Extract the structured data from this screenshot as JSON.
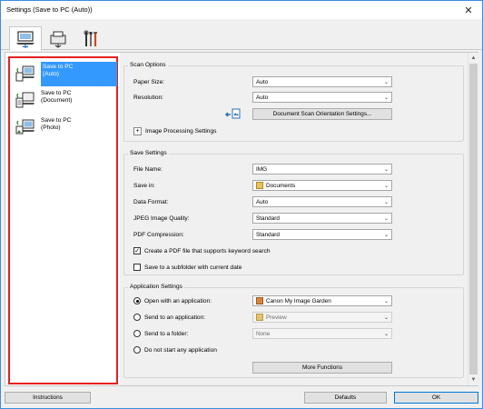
{
  "window": {
    "title": "Settings (Save to PC (Auto))",
    "close_glyph": "✕"
  },
  "tabs": [
    {
      "icon": "scan-from-computer-icon",
      "active": true
    },
    {
      "icon": "scan-from-operation-panel-icon",
      "active": false
    },
    {
      "icon": "general-settings-tools-icon",
      "active": false
    }
  ],
  "left_list": {
    "items": [
      {
        "label_line1": "Save to PC",
        "label_line2": "(Auto)",
        "selected": true,
        "icon": "save-to-pc-auto-icon"
      },
      {
        "label_line1": "Save to PC",
        "label_line2": "(Document)",
        "selected": false,
        "icon": "save-to-pc-document-icon"
      },
      {
        "label_line1": "Save to PC",
        "label_line2": "(Photo)",
        "selected": false,
        "icon": "save-to-pc-photo-icon"
      }
    ],
    "highlight_color": "#e5201f",
    "selection_color": "#3399ff"
  },
  "scan_options": {
    "legend": "Scan Options",
    "paper_size_label": "Paper Size:",
    "paper_size_value": "Auto",
    "resolution_label": "Resolution:",
    "resolution_value": "Auto",
    "orientation_button": "Document Scan Orientation Settings...",
    "image_processing_label": "Image Processing Settings",
    "expand_glyph": "+"
  },
  "save_settings": {
    "legend": "Save Settings",
    "file_name_label": "File Name:",
    "file_name_value": "IMG",
    "save_in_label": "Save in:",
    "save_in_value": "Documents",
    "data_format_label": "Data Format:",
    "data_format_value": "Auto",
    "jpeg_quality_label": "JPEG Image Quality:",
    "jpeg_quality_value": "Standard",
    "pdf_compression_label": "PDF Compression:",
    "pdf_compression_value": "Standard",
    "create_pdf_keyword_label": "Create a PDF file that supports keyword search",
    "create_pdf_keyword_checked": true,
    "save_subfolder_label": "Save to a subfolder with current date",
    "save_subfolder_checked": false,
    "check_glyph": "✓"
  },
  "application_settings": {
    "legend": "Application Settings",
    "open_with_label": "Open with an application:",
    "open_with_value": "Canon My Image Garden",
    "send_to_app_label": "Send to an application:",
    "send_to_app_value": "Preview",
    "send_to_folder_label": "Send to a folder:",
    "send_to_folder_value": "None",
    "do_not_start_label": "Do not start any application",
    "selected_option": "open_with",
    "more_functions_button": "More Functions"
  },
  "footer": {
    "instructions_button": "Instructions",
    "defaults_button": "Defaults",
    "ok_button": "OK"
  },
  "glyphs": {
    "chevron_down": "⌄",
    "scroll_up": "▲",
    "scroll_down": "▼"
  }
}
